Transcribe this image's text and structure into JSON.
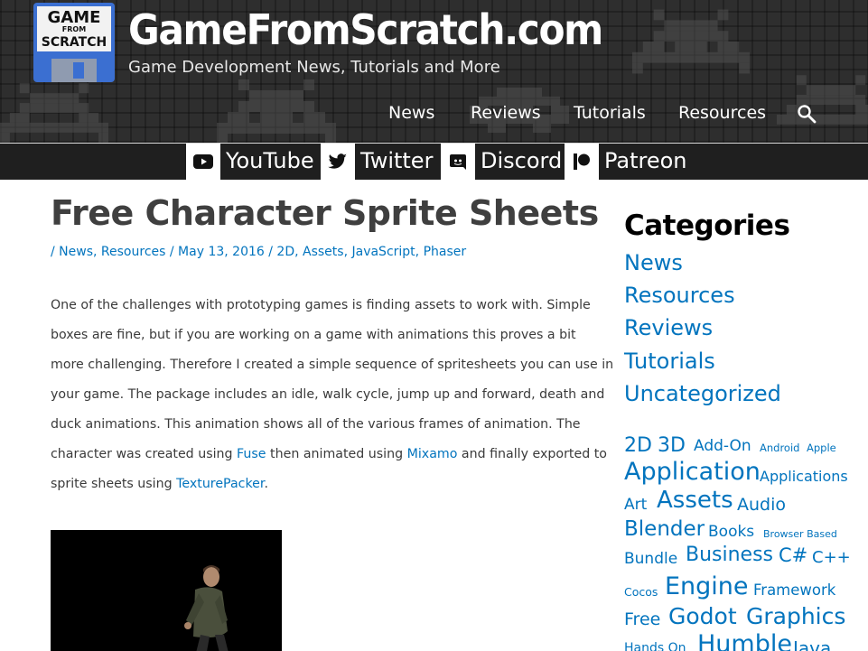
{
  "header": {
    "logo_text": [
      "GAME",
      "FROM",
      "SCRATCH"
    ],
    "site_title": "GameFromScratch.com",
    "tagline": "Game Development News, Tutorials and More",
    "nav": [
      {
        "label": "News"
      },
      {
        "label": "Reviews"
      },
      {
        "label": "Tutorials"
      },
      {
        "label": "Resources"
      }
    ],
    "search_icon": "search-icon"
  },
  "social": [
    {
      "label": "YouTube",
      "icon": "youtube-icon"
    },
    {
      "label": "Twitter",
      "icon": "twitter-icon"
    },
    {
      "label": "Discord",
      "icon": "discord-icon"
    },
    {
      "label": "Patreon",
      "icon": "patreon-icon"
    }
  ],
  "article": {
    "title": "Free Character Sprite Sheets",
    "meta": {
      "prefix": "/ ",
      "categories": [
        "News",
        "Resources"
      ],
      "date": "May 13, 2016",
      "tags": [
        "2D",
        "Assets",
        "JavaScript",
        "Phaser"
      ]
    },
    "body": {
      "line1": "One of the challenges with prototyping games is finding assets to work with.  Simple",
      "line2": "boxes are fine, but if you are working on a game with animations this proves a bit",
      "line3": "more challenging.  Therefore I created a simple sequence of spritesheets you can use in",
      "line4": "your game.   The package includes an idle, walk cycle, jump up and forward, death and",
      "line5": "duck animations.  This animation shows all of the various frames of animation.  The",
      "line6_a": "character was created using ",
      "line6_link1": "Fuse",
      "line6_b": " then animated using ",
      "line6_link2": "Mixamo",
      "line6_c": " and finally exported to",
      "line7_a": "sprite sheets using ",
      "line7_link": "TexturePacker",
      "line7_b": "."
    }
  },
  "sidebar": {
    "categories_heading": "Categories",
    "categories": [
      "News",
      "Resources",
      "Reviews",
      "Tutorials",
      "Uncategorized"
    ],
    "tags": [
      "2D",
      "3D",
      "Add-On",
      "Android",
      "Apple",
      "Application",
      "Applications",
      "Art",
      "Assets",
      "Audio",
      "Blender",
      "Books",
      "Browser Based",
      "Bundle",
      "Business",
      "C#",
      "C++",
      "Cocos",
      "Engine",
      "Framework",
      "Free",
      "Godot",
      "Graphics",
      "Hands On",
      "Humble",
      "Java"
    ]
  },
  "colors": {
    "link": "#0274be",
    "header_bg": "#2e2e2e",
    "social_bar_bg": "#1f1f1f"
  }
}
